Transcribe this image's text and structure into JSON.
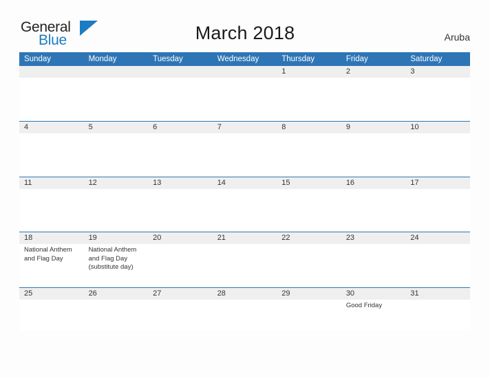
{
  "brand": {
    "name_part1": "General",
    "name_part2": "Blue",
    "mark": "triangle-logo-icon",
    "color_dark": "#231f20",
    "color_blue": "#1b7cc2"
  },
  "header": {
    "title": "March 2018",
    "region": "Aruba"
  },
  "theme": {
    "header_blue": "#2e75b6",
    "separator_blue": "#2e75b6",
    "date_band_gray": "#efefef",
    "page_background": "#fdfdfd",
    "text": "#333333"
  },
  "calendar": {
    "month": "March",
    "year": "2018",
    "day_headers": [
      "Sunday",
      "Monday",
      "Tuesday",
      "Wednesday",
      "Thursday",
      "Friday",
      "Saturday"
    ],
    "weeks": [
      {
        "days": [
          {
            "date": "",
            "event": ""
          },
          {
            "date": "",
            "event": ""
          },
          {
            "date": "",
            "event": ""
          },
          {
            "date": "",
            "event": ""
          },
          {
            "date": "1",
            "event": ""
          },
          {
            "date": "2",
            "event": ""
          },
          {
            "date": "3",
            "event": ""
          }
        ]
      },
      {
        "days": [
          {
            "date": "4",
            "event": ""
          },
          {
            "date": "5",
            "event": ""
          },
          {
            "date": "6",
            "event": ""
          },
          {
            "date": "7",
            "event": ""
          },
          {
            "date": "8",
            "event": ""
          },
          {
            "date": "9",
            "event": ""
          },
          {
            "date": "10",
            "event": ""
          }
        ]
      },
      {
        "days": [
          {
            "date": "11",
            "event": ""
          },
          {
            "date": "12",
            "event": ""
          },
          {
            "date": "13",
            "event": ""
          },
          {
            "date": "14",
            "event": ""
          },
          {
            "date": "15",
            "event": ""
          },
          {
            "date": "16",
            "event": ""
          },
          {
            "date": "17",
            "event": ""
          }
        ]
      },
      {
        "days": [
          {
            "date": "18",
            "event": "National Anthem and Flag Day"
          },
          {
            "date": "19",
            "event": "National Anthem and Flag Day (substitute day)"
          },
          {
            "date": "20",
            "event": ""
          },
          {
            "date": "21",
            "event": ""
          },
          {
            "date": "22",
            "event": ""
          },
          {
            "date": "23",
            "event": ""
          },
          {
            "date": "24",
            "event": ""
          }
        ]
      },
      {
        "days": [
          {
            "date": "25",
            "event": ""
          },
          {
            "date": "26",
            "event": ""
          },
          {
            "date": "27",
            "event": ""
          },
          {
            "date": "28",
            "event": ""
          },
          {
            "date": "29",
            "event": ""
          },
          {
            "date": "30",
            "event": "Good Friday"
          },
          {
            "date": "31",
            "event": ""
          }
        ]
      }
    ]
  }
}
